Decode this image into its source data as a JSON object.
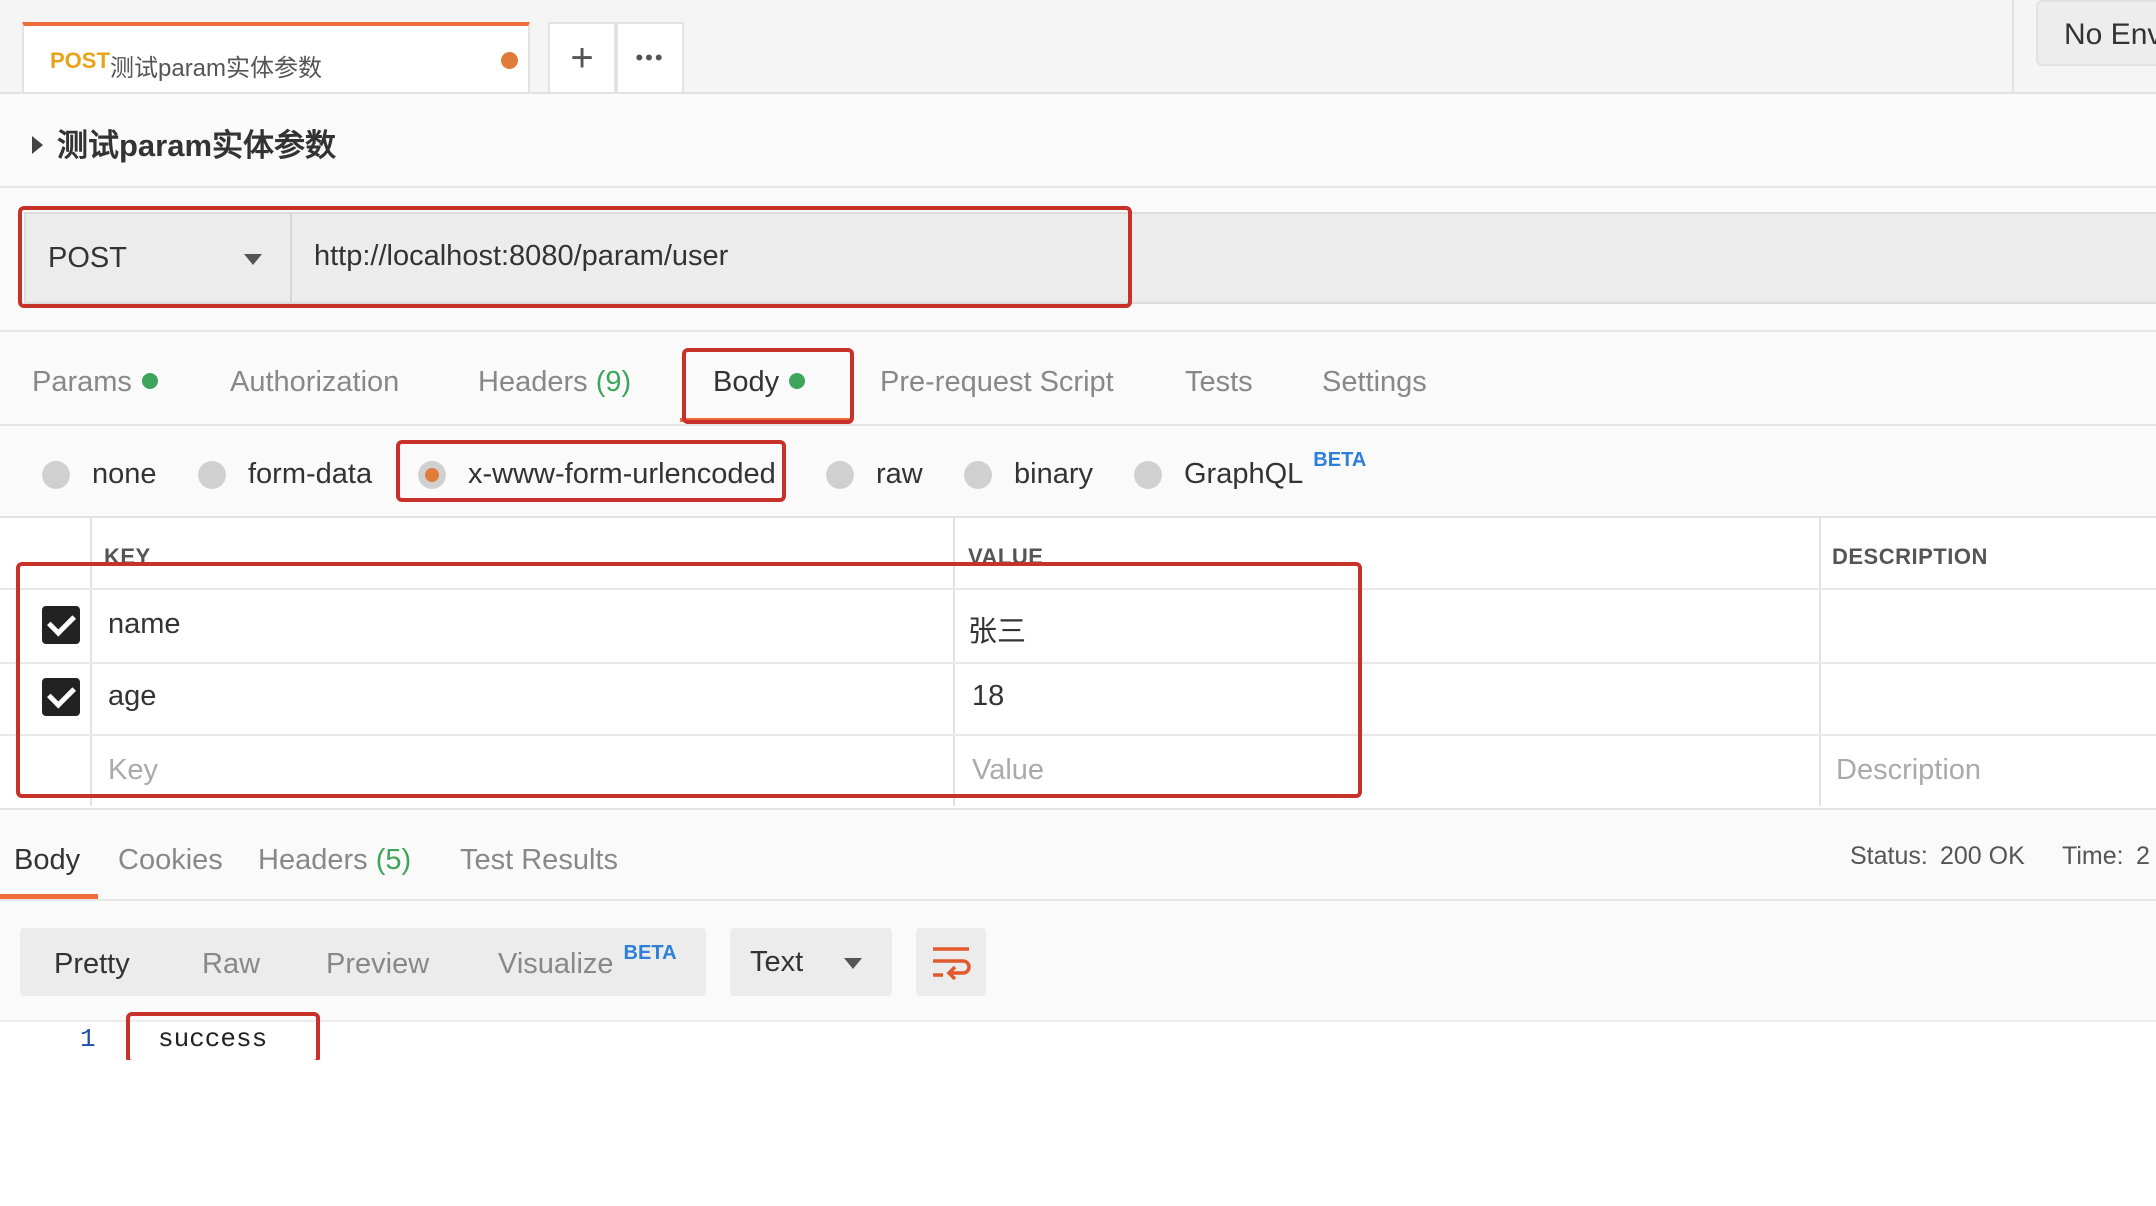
{
  "tabstrip": {
    "tab": {
      "method": "POST",
      "name": "测试param实体参数"
    },
    "add_label": "+",
    "more_label": "•••",
    "environment": "No Env"
  },
  "request": {
    "title": "测试param实体参数",
    "method": "POST",
    "url": "http://localhost:8080/param/user"
  },
  "request_tabs": {
    "params": "Params",
    "authorization": "Authorization",
    "headers": "Headers",
    "headers_count": "(9)",
    "body": "Body",
    "pre_request": "Pre-request Script",
    "tests": "Tests",
    "settings": "Settings"
  },
  "body_types": {
    "none": "none",
    "form_data": "form-data",
    "urlencoded": "x-www-form-urlencoded",
    "raw": "raw",
    "binary": "binary",
    "graphql": "GraphQL",
    "beta": "BETA",
    "selected": "x-www-form-urlencoded"
  },
  "table": {
    "headers": {
      "key": "KEY",
      "value": "VALUE",
      "description": "DESCRIPTION"
    },
    "rows": [
      {
        "checked": true,
        "key": "name",
        "value": "张三"
      },
      {
        "checked": true,
        "key": "age",
        "value": "18"
      }
    ],
    "placeholders": {
      "key": "Key",
      "value": "Value",
      "description": "Description"
    }
  },
  "response": {
    "tabs": {
      "body": "Body",
      "cookies": "Cookies",
      "headers": "Headers",
      "headers_count": "(5)",
      "test_results": "Test Results"
    },
    "status_label": "Status:",
    "status_value": "200 OK",
    "time_label": "Time:",
    "time_value": "2",
    "formats": {
      "pretty": "Pretty",
      "raw": "Raw",
      "preview": "Preview",
      "visualize": "Visualize",
      "beta": "BETA"
    },
    "text_select": "Text",
    "line_number": "1",
    "content": "success"
  },
  "colors": {
    "accent": "#f26b3a",
    "highlight_box": "#c8302a",
    "success": "#3ea55b",
    "beta": "#2e7fd9"
  }
}
